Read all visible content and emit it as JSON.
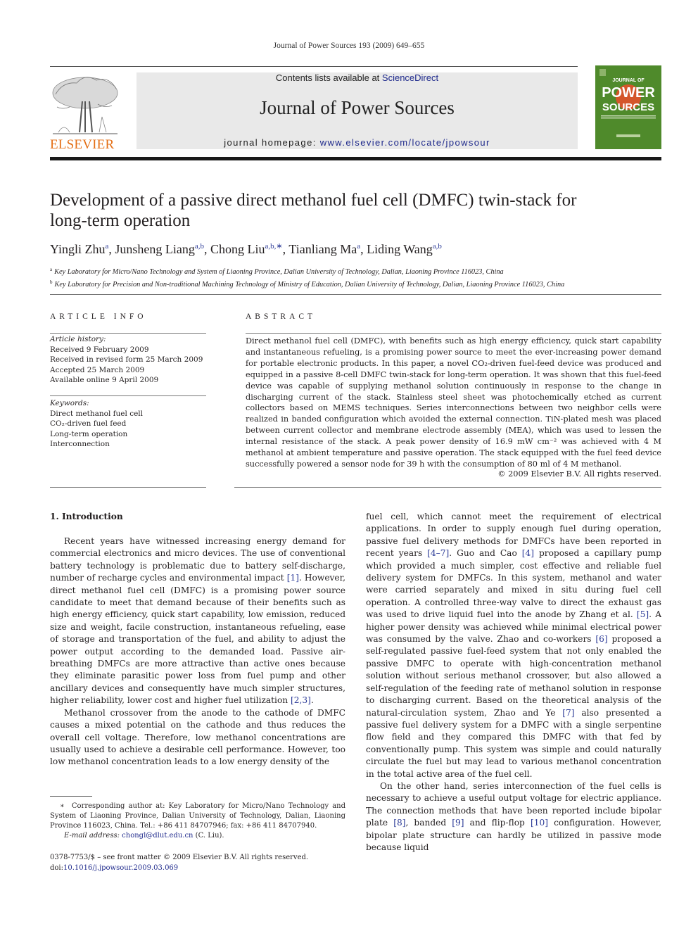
{
  "running_head": "Journal of Power Sources 193 (2009) 649–655",
  "masthead": {
    "publisher_logo_word": "ELSEVIER",
    "contents_prefix": "Contents lists available at ",
    "contents_link": "ScienceDirect",
    "journal_title": "Journal of Power Sources",
    "homepage_prefix": "journal homepage: ",
    "homepage_link": "www.elsevier.com/locate/jpowsour",
    "cover": {
      "top_line": "JOURNAL OF",
      "word1": "POWER",
      "word2": "SOURCES",
      "colors": {
        "background": "#4f8a2b",
        "sun": "#d4562a"
      }
    },
    "colors": {
      "elsevier_orange": "#e46f16",
      "link_blue": "#1f2a8c",
      "banner_gray": "#e9e9e9"
    }
  },
  "article": {
    "title_line1": "Development of a passive direct methanol fuel cell (DMFC) twin-stack for",
    "title_line2": "long-term operation",
    "authors": [
      {
        "name": "Yingli Zhu",
        "affil": "a"
      },
      {
        "name": "Junsheng Liang",
        "affil": "a,b"
      },
      {
        "name": "Chong Liu",
        "affil": "a,b,∗"
      },
      {
        "name": "Tianliang Ma",
        "affil": "a"
      },
      {
        "name": "Liding Wang",
        "affil": "a,b"
      }
    ],
    "affiliations": [
      {
        "key": "a",
        "text": "Key Laboratory for Micro/Nano Technology and System of Liaoning Province, Dalian University of Technology, Dalian, Liaoning Province 116023, China"
      },
      {
        "key": "b",
        "text": "Key Laboratory for Precision and Non-traditional Machining Technology of Ministry of Education, Dalian University of Technology, Dalian, Liaoning Province 116023, China"
      }
    ]
  },
  "article_info": {
    "heading": "ARTICLE INFO",
    "history_label": "Article history:",
    "history": [
      "Received 9 February 2009",
      "Received in revised form 25 March 2009",
      "Accepted 25 March 2009",
      "Available online 9 April 2009"
    ],
    "keywords_label": "Keywords:",
    "keywords": [
      "Direct methanol fuel cell",
      "CO₂-driven fuel feed",
      "Long-term operation",
      "Interconnection"
    ]
  },
  "abstract": {
    "heading": "ABSTRACT",
    "text": "Direct methanol fuel cell (DMFC), with benefits such as high energy efficiency, quick start capability and instantaneous refueling, is a promising power source to meet the ever-increasing power demand for portable electronic products. In this paper, a novel CO₂-driven fuel-feed device was produced and equipped in a passive 8-cell DMFC twin-stack for long-term operation. It was shown that this fuel-feed device was capable of supplying methanol solution continuously in response to the change in discharging current of the stack. Stainless steel sheet was photochemically etched as current collectors based on MEMS techniques. Series interconnections between two neighbor cells were realized in banded configuration which avoided the external connection. TiN-plated mesh was placed between current collector and membrane electrode assembly (MEA), which was used to lessen the internal resistance of the stack. A peak power density of 16.9 mW cm⁻² was achieved with 4 M methanol at ambient temperature and passive operation. The stack equipped with the fuel feed device successfully powered a sensor node for 39 h with the consumption of 80 ml of 4 M methanol.",
    "copyright": "© 2009 Elsevier B.V. All rights reserved."
  },
  "body": {
    "section_heading": "1.  Introduction",
    "left_paragraphs": [
      [
        {
          "t": "Recent years have witnessed increasing energy demand for commercial electronics and micro devices. The use of conventional battery technology is problematic due to battery self-discharge, number of recharge cycles and environmental impact "
        },
        {
          "c": "[1]"
        },
        {
          "t": ". However, direct methanol fuel cell (DMFC) is a promising power source candidate to meet that demand because of their benefits such as high energy efficiency, quick start capability, low emission, reduced size and weight, facile construction, instantaneous refueling, ease of storage and transportation of the fuel, and ability to adjust the power output according to the demanded load. Passive air-breathing DMFCs are more attractive than active ones because they eliminate parasitic power loss from fuel pump and other ancillary devices and consequently have much simpler structures, higher reliability, lower cost and higher fuel utilization "
        },
        {
          "c": "[2,3]"
        },
        {
          "t": "."
        }
      ],
      [
        {
          "t": "Methanol crossover from the anode to the cathode of DMFC causes a mixed potential on the cathode and thus reduces the overall cell voltage. Therefore, low methanol concentrations are usually used to achieve a desirable cell performance. However, too low methanol concentration leads to a low energy density of the"
        }
      ]
    ],
    "right_paragraphs": [
      [
        {
          "t": "fuel cell, which cannot meet the requirement of electrical applications. In order to supply enough fuel during operation, passive fuel delivery methods for DMFCs have been reported in recent years "
        },
        {
          "c": "[4–7]"
        },
        {
          "t": ". Guo and Cao "
        },
        {
          "c": "[4]"
        },
        {
          "t": " proposed a capillary pump which provided a much simpler, cost effective and reliable fuel delivery system for DMFCs. In this system, methanol and water were carried separately and mixed in situ during fuel cell operation. A controlled three-way valve to direct the exhaust gas was used to drive liquid fuel into the anode by Zhang et al. "
        },
        {
          "c": "[5]"
        },
        {
          "t": ". A higher power density was achieved while minimal electrical power was consumed by the valve. Zhao and co-workers "
        },
        {
          "c": "[6]"
        },
        {
          "t": " proposed a self-regulated passive fuel-feed system that not only enabled the passive DMFC to operate with high-concentration methanol solution without serious methanol crossover, but also allowed a self-regulation of the feeding rate of methanol solution in response to discharging current. Based on the theoretical analysis of the natural-circulation system, Zhao and Ye "
        },
        {
          "c": "[7]"
        },
        {
          "t": " also presented a passive fuel delivery system for a DMFC with a single serpentine flow field and they compared this DMFC with that fed by conventionally pump. This system was simple and could naturally circulate the fuel but may lead to various methanol concentration in the total active area of the fuel cell."
        }
      ],
      [
        {
          "t": "On the other hand, series interconnection of the fuel cells is necessary to achieve a useful output voltage for electric appliance. The connection methods that have been reported include bipolar plate "
        },
        {
          "c": "[8]"
        },
        {
          "t": ", banded "
        },
        {
          "c": "[9]"
        },
        {
          "t": " and flip-flop "
        },
        {
          "c": "[10]"
        },
        {
          "t": " configuration. However, bipolar plate structure can hardly be utilized in passive mode because liquid"
        }
      ]
    ]
  },
  "footnote": {
    "marker": "∗",
    "text": "Corresponding author at: Key Laboratory for Micro/Nano Technology and System of Liaoning Province, Dalian University of Technology, Dalian, Liaoning Province 116023, China. Tel.: +86 411 84707946; fax: +86 411 84707940.",
    "email_label": "E-mail address: ",
    "email": "chongl@dlut.edu.cn",
    "email_suffix": " (C. Liu)."
  },
  "front_matter": {
    "issn_line": "0378-7753/$ – see front matter © 2009 Elsevier B.V. All rights reserved.",
    "doi_prefix": "doi:",
    "doi": "10.1016/j.jpowsour.2009.03.069"
  }
}
